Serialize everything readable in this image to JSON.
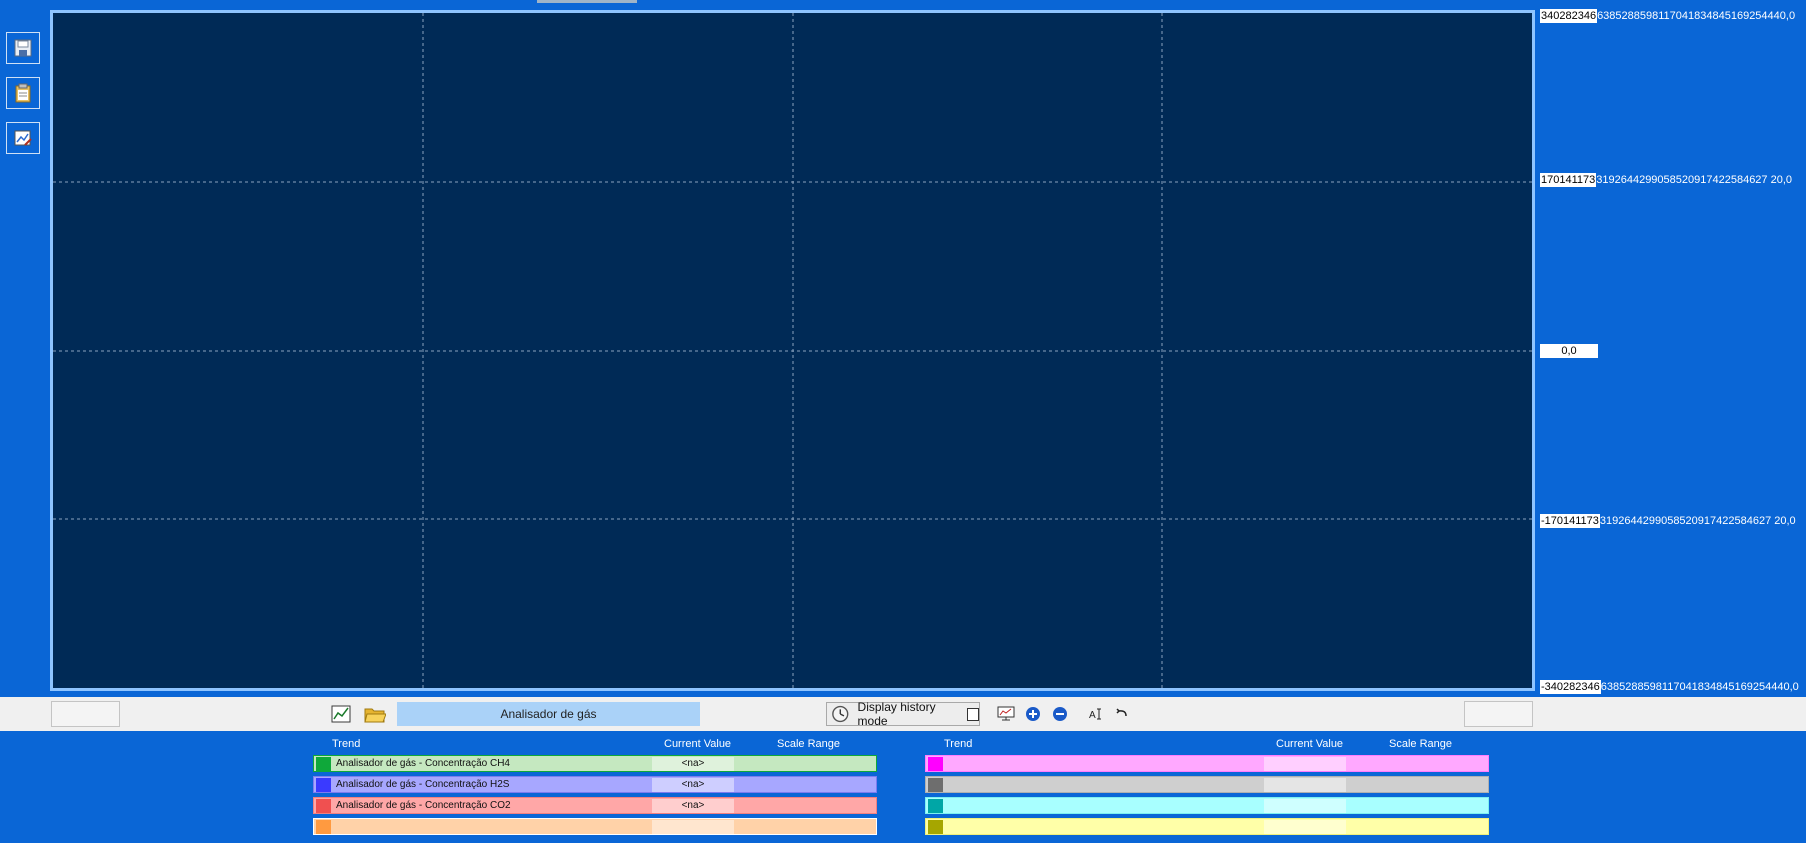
{
  "y_axis": {
    "ticks": [
      {
        "boxed": "340282346",
        "rest": "6385288598117041834845169254440,0"
      },
      {
        "boxed": "170141173",
        "rest": "3192644299058520917422584627 20,0"
      },
      {
        "boxed": "0,0",
        "rest": ""
      },
      {
        "boxed": "-170141173",
        "rest": "3192644299058520917422584627 20,0"
      },
      {
        "boxed": "-340282346",
        "rest": "6385288598117041834845169254440,0"
      }
    ]
  },
  "chart_data": {
    "type": "line",
    "series": [],
    "ylim": [
      -3.4028234663852886e+38,
      3.4028234663852886e+38
    ],
    "grid": true
  },
  "left_toolbar": {
    "icons": [
      "save-icon",
      "clipboard-icon",
      "edit-chart-icon"
    ]
  },
  "toolbar": {
    "chart_name": "Analisador de gás",
    "history_label": "Display history mode"
  },
  "legend_left": {
    "headers": {
      "trend": "Trend",
      "current_value": "Current Value",
      "scale_range": "Scale Range"
    },
    "rows": [
      {
        "name": "Analisador de gás - Concentração CH4",
        "value": "<na>",
        "color": "#0fa83a",
        "bg": "#c5e8c0",
        "border": "#0fa83a"
      },
      {
        "name": "Analisador de gás - Concentração H2S",
        "value": "<na>",
        "color": "#3a3aff",
        "bg": "#a7a7ff",
        "border": "#7c7cf0"
      },
      {
        "name": "Analisador de gás - Concentração CO2",
        "value": "<na>",
        "color": "#f05050",
        "bg": "#ffa7a7",
        "border": "#f08080"
      },
      {
        "name": "",
        "value": "",
        "color": "#ff9a40",
        "bg": "#ffd2a8",
        "border": "#ffffff"
      }
    ]
  },
  "legend_right": {
    "headers": {
      "trend": "Trend",
      "current_value": "Current Value",
      "scale_range": "Scale Range"
    },
    "rows": [
      {
        "name": "",
        "value": "",
        "color": "#ff00ff",
        "bg": "#ffa8ff",
        "border": "#ff7cff"
      },
      {
        "name": "",
        "value": "",
        "color": "#6e6e6e",
        "bg": "#cfcfcf",
        "border": "#b0b0b0"
      },
      {
        "name": "",
        "value": "",
        "color": "#00a6a6",
        "bg": "#a8ffff",
        "border": "#7cf0f0"
      },
      {
        "name": "",
        "value": "",
        "color": "#a6a600",
        "bg": "#ffffa8",
        "border": "#f0f07c"
      }
    ]
  }
}
